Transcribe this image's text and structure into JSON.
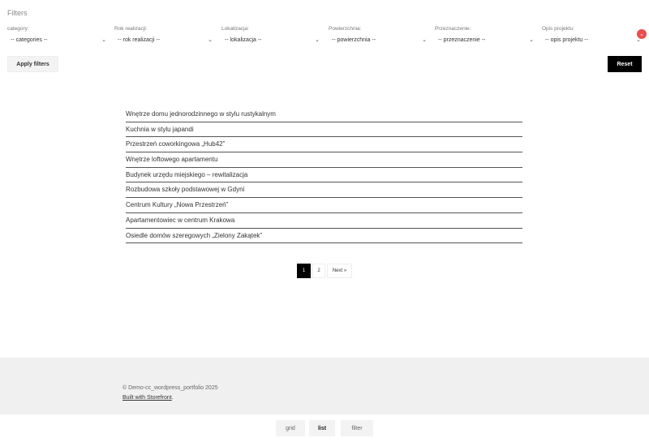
{
  "filters": {
    "title": "Filters",
    "groups": [
      {
        "label": "category:",
        "value": "-- categories --"
      },
      {
        "label": "Rok realizacji:",
        "value": "-- rok realizacji --"
      },
      {
        "label": "Lokalizacja:",
        "value": "-- lokalizacja --"
      },
      {
        "label": "Powierzchnia:",
        "value": "-- powierzchnia --"
      },
      {
        "label": "Przeznaczenie:",
        "value": "-- przeznaczenie --"
      },
      {
        "label": "Opis projektu:",
        "value": "-- opis projektu --"
      }
    ],
    "apply_label": "Apply filters",
    "reset_label": "Reset"
  },
  "icons": {
    "chevron": "chevron-down-icon",
    "scroll": "arrow-up-icon",
    "scroll_color": "#e94e4e"
  },
  "projects": [
    "Wnętrze domu jednorodzinnego w stylu rustykalnym",
    "Kuchnia w stylu japandi",
    "Przestrzeń coworkingowa „Hub42”",
    "Wnętrze loftowego apartamentu",
    "Budynek urzędu miejskiego – rewitalizacja",
    "Rozbudowa szkoły podstawowej w Gdyni",
    "Centrum Kultury „Nowa Przestrzeń”",
    "Apartamentowiec w centrum Krakowa",
    "Osiedle domów szeregowych „Zielony Zakątek”"
  ],
  "pagination": {
    "current": "1",
    "page2": "2",
    "next": "Next »"
  },
  "footer": {
    "copyright": "© Demo-cc_wordpress_portfolio 2025",
    "credit_link": "Built with Storefront",
    "credit_suffix": "."
  },
  "bottom_nav": {
    "grid": "grid",
    "list": "list",
    "filter": "filter"
  }
}
